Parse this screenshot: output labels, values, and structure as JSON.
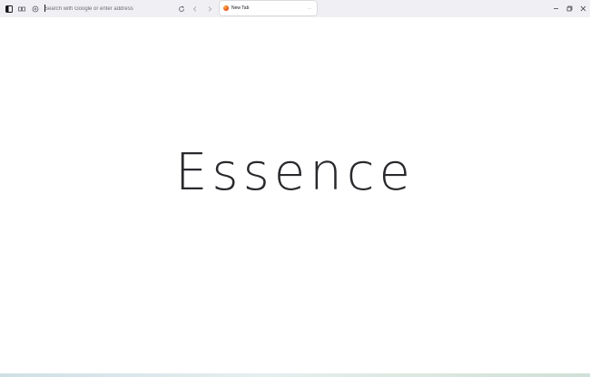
{
  "toolbar": {
    "sidebar_icon": "sidebar-icon",
    "tabs_icon": "tab-manager-icon",
    "site_info_icon": "site-info-icon",
    "url_placeholder": "Search with Google or enter address",
    "url_value": "",
    "reload_icon": "reload-icon",
    "back_icon": "chevron-left-icon",
    "forward_icon": "chevron-right-icon"
  },
  "tab": {
    "title": "New Tab",
    "favicon": "browser-favicon-icon",
    "close": "…"
  },
  "window_controls": {
    "minimize_icon": "minimize-icon",
    "restore_icon": "restore-icon",
    "close_icon": "close-icon"
  },
  "page": {
    "brand_text": "Essence"
  },
  "colors": {
    "toolbar_bg": "#f0f0f4",
    "page_bg": "#ffffff",
    "text": "#2a2a2e"
  }
}
